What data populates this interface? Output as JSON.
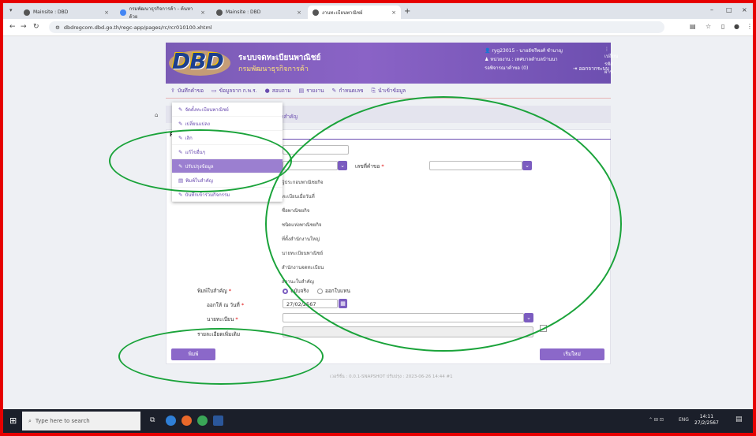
{
  "browser": {
    "tabs": [
      {
        "title": "Mainsite : DBD",
        "icon": "site-icon"
      },
      {
        "title": "กรมพัฒนาธุรกิจการค้า - ค้นหาด้วย",
        "icon": "google-icon"
      },
      {
        "title": "Mainsite : DBD",
        "icon": "site-icon"
      },
      {
        "title": "งานทะเบียนพาณิชย์",
        "icon": "site-icon"
      }
    ],
    "url": "dbdregcom.dbd.go.th/regc-app/pages/rc/rcr010100.xhtml"
  },
  "header": {
    "logo": "DBD",
    "system_title": "ระบบจดทะเบียนพาณิชย์",
    "system_subtitle": "กรมพัฒนาธุรกิจการค้า",
    "user": "ryg23015 - นายอัชรีพงศ์ ชำนาญ",
    "change_password": "เปลี่ยนรหัสผ่าน",
    "agency": "หน่วยงาน : เทศบาลตำบลบ้านนา",
    "pending": "รอพิจารณาคำขอ (0)",
    "logout": "ออกจากระบบ"
  },
  "menu": [
    {
      "label": "บันทึกคำขอ",
      "icon": "upload-icon"
    },
    {
      "label": "ข้อมูลจาก ก.พ.ร.",
      "icon": "monitor-icon"
    },
    {
      "label": "สอบถาม",
      "icon": "chat-icon"
    },
    {
      "label": "รายงาน",
      "icon": "report-icon"
    },
    {
      "label": "กำหนดเลข",
      "icon": "edit-icon"
    },
    {
      "label": "นำเข้าข้อมูล",
      "icon": "import-icon"
    }
  ],
  "dropdown": [
    {
      "label": "จัดตั้งทะเบียนพาณิชย์",
      "active": false
    },
    {
      "label": "เปลี่ยนแปลง",
      "active": false
    },
    {
      "label": "เลิก",
      "active": false
    },
    {
      "label": "แก้ไขอื่นๆ",
      "active": false
    },
    {
      "label": "ปรับปรุงข้อมูล",
      "active": true
    },
    {
      "label": "พิมพ์ใบสำคัญ",
      "active": false
    },
    {
      "label": "บันทึกเข้าร่วมกิจกรรม",
      "active": false
    }
  ],
  "form": {
    "breadcrumb": "ำสำคัญ",
    "section_letter": "R",
    "request_no_label": "เลขที่คำขอ",
    "list": [
      "ผู้ประกอบพาณิชยกิจ",
      "ทะเบียนเมื่อวันที่",
      "ชื่อพาณิชยกิจ",
      "ชนิดแห่งพาณิชยกิจ",
      "ที่ตั้งสำนักงานใหญ่",
      "นายทะเบียนพาณิชย์",
      "สำนักงานจดทะเบียน",
      "สถานะใบสำคัญ"
    ],
    "print_label": "พิมพ์ใบสำคัญ",
    "print_options": [
      "ฉบับจริง",
      "ออกใบแทน"
    ],
    "issue_date_label": "ออกให้ ณ วันที่",
    "issue_date_value": "27/02/2567",
    "registrar_label": "นายทะเบียน",
    "extra_label": "รายละเอียดเพิ่มเติม",
    "print_button": "พิมพ์",
    "reset_button": "เริ่มใหม่",
    "version": "เวอร์ชั่น : 0.0.1-SNAPSHOT ปรับปรุง : 2023-06-26 14:44 #1"
  },
  "taskbar": {
    "search_placeholder": "Type here to search",
    "lang": "ENG",
    "time": "14:11",
    "date": "27/2/2567"
  }
}
